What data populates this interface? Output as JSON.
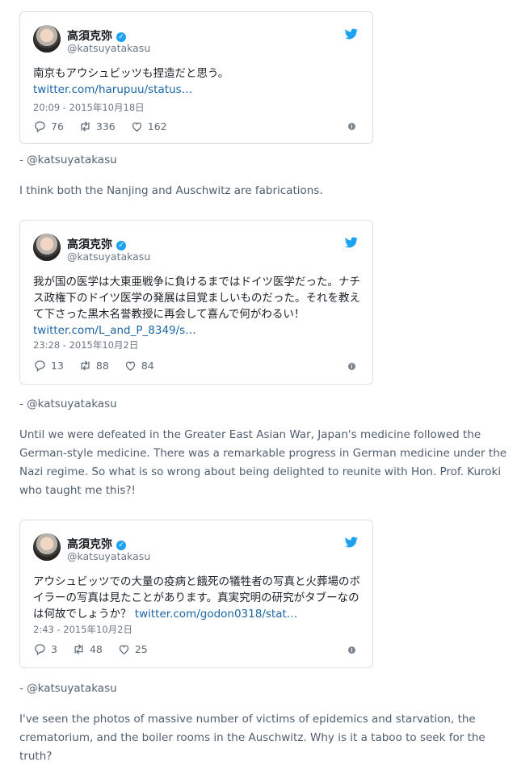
{
  "tweets": [
    {
      "name": "高須克弥",
      "handle": "@katsuyatakasu",
      "text": "南京もアウシュビッツも捏造だと思う。",
      "link": "twitter.com/harupuu/status…",
      "time": "20:09 - 2015年10月18日",
      "replies": "76",
      "retweets": "336",
      "likes": "162"
    },
    {
      "name": "高須克弥",
      "handle": "@katsuyatakasu",
      "text": "我が国の医学は大東亜戦争に負けるまではドイツ医学だった。ナチス政権下のドイツ医学の発展は目覚ましいものだった。それを教えて下さった黒木名誉教授に再会して喜んで何がわるい！",
      "link": "twitter.com/L_and_P_8349/s…",
      "time": "23:28 - 2015年10月2日",
      "replies": "13",
      "retweets": "88",
      "likes": "84"
    },
    {
      "name": "高須克弥",
      "handle": "@katsuyatakasu",
      "text": "アウシュビッツでの大量の疫病と餓死の犠牲者の写真と火葬場のボイラーの写真は見たことがあります。真実究明の研究がタブーなのは何故でしょうか？",
      "link": "twitter.com/godon0318/stat…",
      "time": "2:43 - 2015年10月2日",
      "replies": "3",
      "retweets": "48",
      "likes": "25"
    }
  ],
  "attributions": [
    "- @katsuyatakasu",
    "- @katsuyatakasu",
    "- @katsuyatakasu"
  ],
  "translations": [
    "I think both the Nanjing and Auschwitz are fabrications.",
    "Until we were defeated in the Greater East Asian War, Japan's medicine followed the German-style medicine. There was a remarkable progress in German medicine under the Nazi regime. So what is so wrong about being delighted to reunite with Hon. Prof. Kuroki who taught me this?!",
    "I've seen the photos of massive number of victims of epidemics and starvation, the crematorium, and the boiler rooms in the Auschwitz. Why is it a taboo to seek for the truth?"
  ],
  "colors": {
    "accent": "#1da1f2",
    "link": "#1b65a5"
  },
  "icons": [
    "twitter-bird-icon",
    "reply-icon",
    "retweet-icon",
    "like-icon",
    "info-icon",
    "verified-badge-icon"
  ]
}
